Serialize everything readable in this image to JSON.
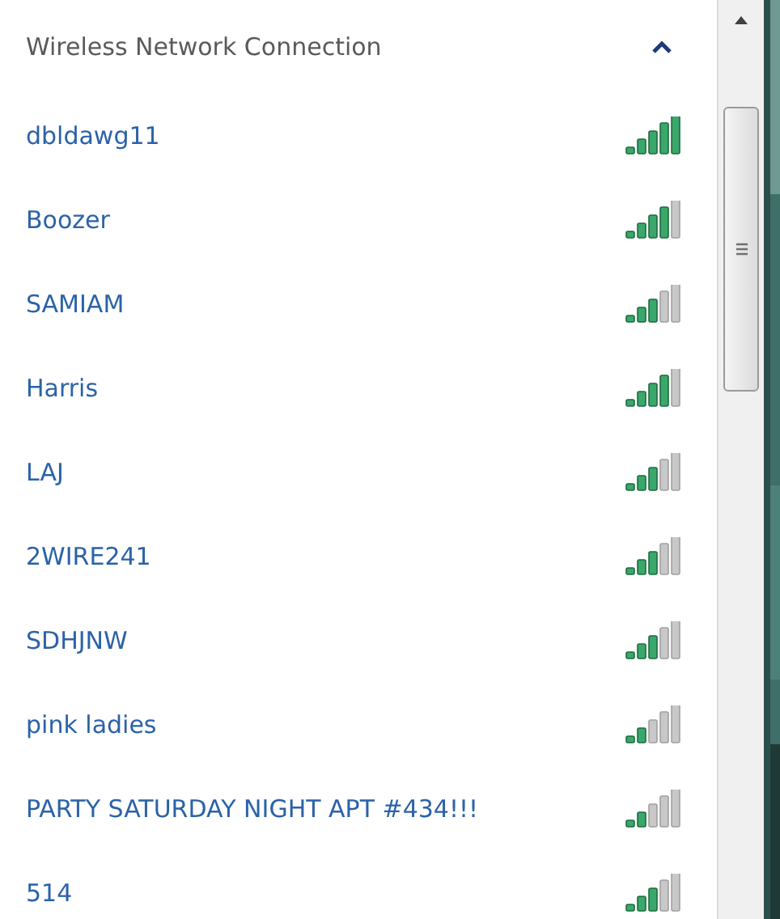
{
  "section": {
    "title": "Wireless Network Connection",
    "expanded": true
  },
  "networks": [
    {
      "name": "dbldawg11",
      "kind": "excellent"
    },
    {
      "name": "Boozer",
      "kind": "strong"
    },
    {
      "name": "SAMIAM",
      "kind": "good"
    },
    {
      "name": "Harris",
      "kind": "strong"
    },
    {
      "name": "LAJ",
      "kind": "good"
    },
    {
      "name": "2WIRE241",
      "kind": "good"
    },
    {
      "name": "SDHJNW",
      "kind": "good"
    },
    {
      "name": "pink ladies",
      "kind": "weak"
    },
    {
      "name": "PARTY SATURDAY NIGHT APT #434!!!",
      "kind": "weak"
    },
    {
      "name": "514",
      "kind": "good"
    }
  ]
}
